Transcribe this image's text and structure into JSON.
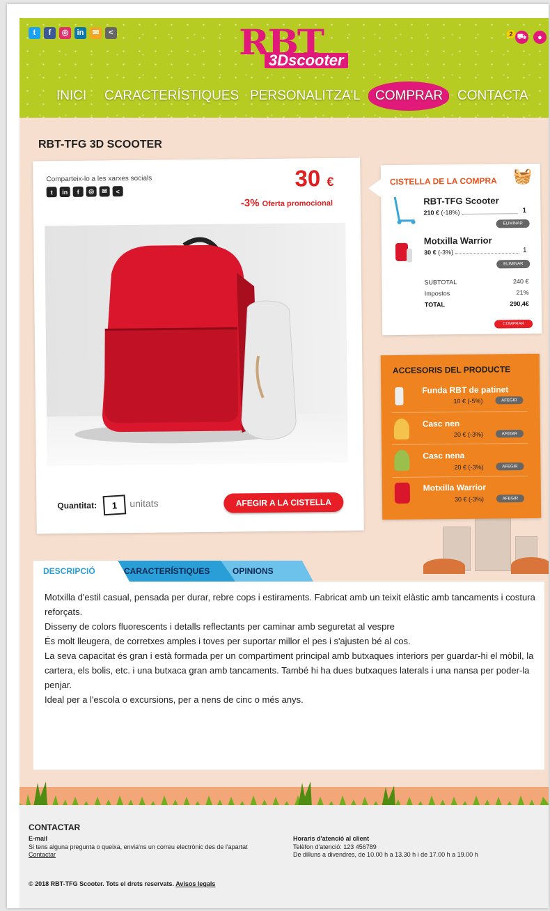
{
  "brand": {
    "logo_main": "RBT",
    "logo_sub": "3Dscooter",
    "color": "#e1197a",
    "header_color": "#b6cc22"
  },
  "header": {
    "social_icons": [
      "twitter-icon",
      "facebook-icon",
      "instagram-icon",
      "linkedin-icon",
      "email-icon",
      "share-icon"
    ],
    "cart_count": "2",
    "nav": [
      "INICI",
      "CARACTERÍSTIQUES",
      "PERSONALITZA'L",
      "COMPRAR",
      "CONTACTA"
    ],
    "active_nav": "COMPRAR"
  },
  "product": {
    "title": "RBT-TFG 3D SCOOTER",
    "share_label": "Comparteix-lo a les xarxes socials",
    "price": "30",
    "currency": "€",
    "discount": "-3%",
    "discount_label": "Oferta promocional",
    "quantity_label": "Quantitat:",
    "quantity": "1",
    "quantity_unit": "unitats",
    "add_button": "AFEGIR A LA CISTELLA"
  },
  "cart": {
    "title": "CISTELLA DE LA COMPRA",
    "items": [
      {
        "name": "RBT-TFG Scooter",
        "price": "210 €",
        "discount": "(-18%)",
        "qty": "1",
        "remove": "ELIMINAR"
      },
      {
        "name": "Motxilla Warrior",
        "price": "30 €",
        "discount": "(-3%)",
        "qty": "1",
        "remove": "ELIMINAR"
      }
    ],
    "subtotal_label": "SUBTOTAL",
    "subtotal": "240 €",
    "taxes_label": "Impostos",
    "taxes": "21%",
    "total_label": "TOTAL",
    "total": "290,4€",
    "buy_button": "COMPRAR"
  },
  "accessories": {
    "title": "ACCESORIS DEL PRODUCTE",
    "items": [
      {
        "name": "Funda RBT de patinet",
        "price": "10 €",
        "discount": "(-5%)",
        "button": "AFEGIR"
      },
      {
        "name": "Casc nen",
        "price": "20 €",
        "discount": "(-3%)",
        "button": "AFEGIR"
      },
      {
        "name": "Casc nena",
        "price": "20 €",
        "discount": "(-3%)",
        "button": "AFEGIR"
      },
      {
        "name": "Motxilla Warrior",
        "price": "30 €",
        "discount": "(-3%)",
        "button": "AFEGIR"
      }
    ]
  },
  "tabs": [
    "DESCRIPCIÓ",
    "CARACTERÍSTIQUES",
    "OPINIONS"
  ],
  "description": [
    "Motxilla d'estil casual, pensada per durar, rebre cops i estiraments. Fabricat amb un teixit elàstic amb tancaments i costura reforçats.",
    "Disseny de colors fluorescents i detalls reflectants per caminar amb seguretat al vespre",
    "És molt lleugera, de corretxes amples i toves per suportar millor el pes i s'ajusten bé al cos.",
    "La seva capacitat és gran i està formada per un compartiment principal amb butxaques interiors per guardar-hi el mòbil, la cartera, els bolis, etc. i una butxaca gran amb tancaments. També hi ha dues butxaques laterals i una nansa per poder-la penjar.",
    "Ideal per a l'escola o excursions, per a nens de cinc o més anys."
  ],
  "footer": {
    "title": "CONTACTAR",
    "email_title": "E-mail",
    "email_text": "Si tens alguna pregunta o queixa, envia'ns un correu electrònic des de l'apartat",
    "email_link": "Contactar",
    "hours_title": "Horaris d'atenció al client",
    "phone": "Telèfon d'atenció: 123 456789",
    "hours": "De dilluns a divendres, de 10.00 h a 13.30 h i de 17.00 h  a 19.00 h",
    "copyright": "© 2018 RBT-TFG Scooter. Tots el drets reservats.",
    "legal_link": "Avisos legals"
  }
}
